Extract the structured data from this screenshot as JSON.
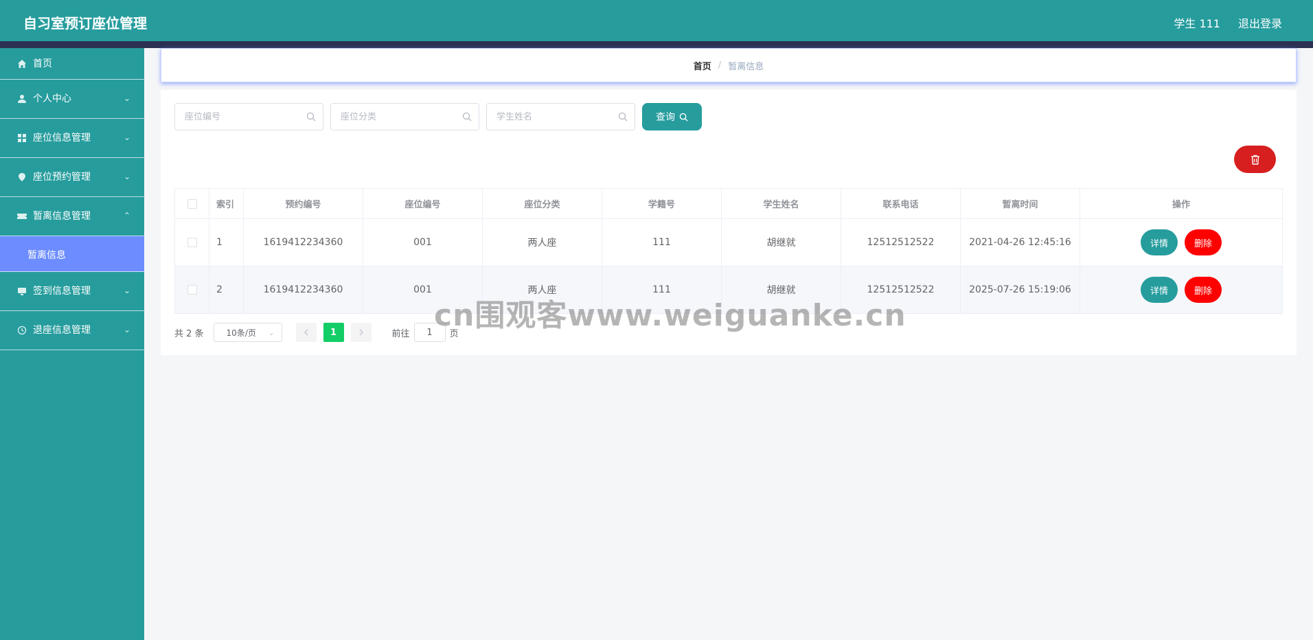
{
  "header": {
    "title": "自习室预订座位管理",
    "user": "学生 111",
    "logout": "退出登录"
  },
  "sidebar": {
    "items": [
      {
        "label": "首页",
        "icon": "home-icon"
      },
      {
        "label": "个人中心",
        "icon": "user-icon"
      },
      {
        "label": "座位信息管理",
        "icon": "grid-icon"
      },
      {
        "label": "座位预约管理",
        "icon": "location-icon"
      },
      {
        "label": "暂离信息管理",
        "icon": "ticket-icon"
      },
      {
        "label": "签到信息管理",
        "icon": "monitor-icon"
      },
      {
        "label": "退座信息管理",
        "icon": "clock-icon"
      }
    ],
    "active_sub": "暂离信息"
  },
  "breadcrumb": {
    "home": "首页",
    "separator": "/",
    "current": "暂离信息"
  },
  "search": {
    "seat_no_placeholder": "座位编号",
    "seat_type_placeholder": "座位分类",
    "student_name_placeholder": "学生姓名",
    "query_label": "查询"
  },
  "table": {
    "headers": [
      "索引",
      "预约编号",
      "座位编号",
      "座位分类",
      "学籍号",
      "学生姓名",
      "联系电话",
      "暂离时间",
      "操作"
    ],
    "rows": [
      {
        "index": "1",
        "booking_no": "1619412234360",
        "seat_no": "001",
        "seat_type": "两人座",
        "student_id": "111",
        "name": "胡继就",
        "phone": "12512512522",
        "time": "2021-04-26 12:45:16"
      },
      {
        "index": "2",
        "booking_no": "1619412234360",
        "seat_no": "001",
        "seat_type": "两人座",
        "student_id": "111",
        "name": "胡继就",
        "phone": "12512512522",
        "time": "2025-07-26 15:19:06"
      }
    ],
    "detail_label": "详情",
    "delete_label": "删除"
  },
  "pagination": {
    "total": "共 2 条",
    "page_size": "10条/页",
    "current_page": "1",
    "goto": "前往",
    "goto_value": "1",
    "page_unit": "页"
  },
  "watermark": "cn围观客www.weiguanke.cn",
  "colors": {
    "primary": "#269c9d",
    "header_dark": "#2c3151",
    "active_sub": "#6c8cff",
    "danger": "#ff0000",
    "danger_dark": "#d71f1f",
    "page_active": "#13ce66"
  }
}
